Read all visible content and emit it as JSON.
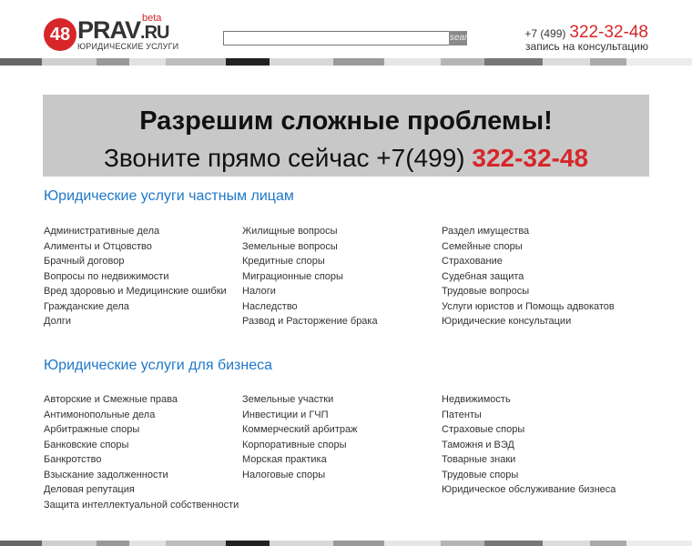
{
  "header": {
    "logo_number": "48",
    "logo_word": "PRAV",
    "logo_tld": ".RU",
    "logo_beta": "beta",
    "logo_sub": "ЮРИДИЧЕСКИЕ УСЛУГИ",
    "search_value": "",
    "search_button": "search",
    "phone_prefix": "+7 (499)",
    "phone_number": "322-32-48",
    "phone_sub": "запись на консультацию"
  },
  "banner": {
    "line1": "Разрешим сложные проблемы!",
    "line2_prefix": "Звоните прямо сейчас +7(499)",
    "line2_number": "322-32-48"
  },
  "private": {
    "title": "Юридические услуги частным лицам",
    "columns": [
      [
        "Административные дела",
        "Алименты и Отцовство",
        "Брачный договор",
        "Вопросы по недвижимости",
        "Вред здоровью и Медицинские ошибки",
        "Гражданские дела",
        "Долги"
      ],
      [
        "Жилищные вопросы",
        "Земельные вопросы",
        "Кредитные споры",
        "Миграционные споры",
        "Налоги",
        "Наследство",
        "Развод и Расторжение брака"
      ],
      [
        "Раздел имущества",
        "Семейные споры",
        "Страхование",
        "Судебная защита",
        "Трудовые вопросы",
        "Услуги юристов и Помощь адвокатов",
        "Юридические консультации"
      ]
    ]
  },
  "business": {
    "title": "Юридические услуги для бизнеса",
    "columns": [
      [
        "Авторские и Смежные права",
        "Антимонопольные дела",
        "Арбитражные споры",
        "Банковские споры",
        "Банкротство",
        "Взыскание задолженности",
        "Деловая репутация",
        "Защита интеллектуальной собственности"
      ],
      [
        "Земельные участки",
        "Инвестиции и ГЧП",
        "Коммерческий арбитраж",
        "Корпоративные споры",
        "Морская практика",
        "Налоговые споры"
      ],
      [
        "Недвижимость",
        "Патенты",
        "Страховые споры",
        "Таможня и ВЭД",
        "Товарные знаки",
        "Трудовые споры",
        "Юридическое обслуживание бизнеса"
      ]
    ]
  },
  "colors": {
    "accent": "#d7262a",
    "link_title": "#1f78c8",
    "banner_bg": "#c8c8c8"
  }
}
